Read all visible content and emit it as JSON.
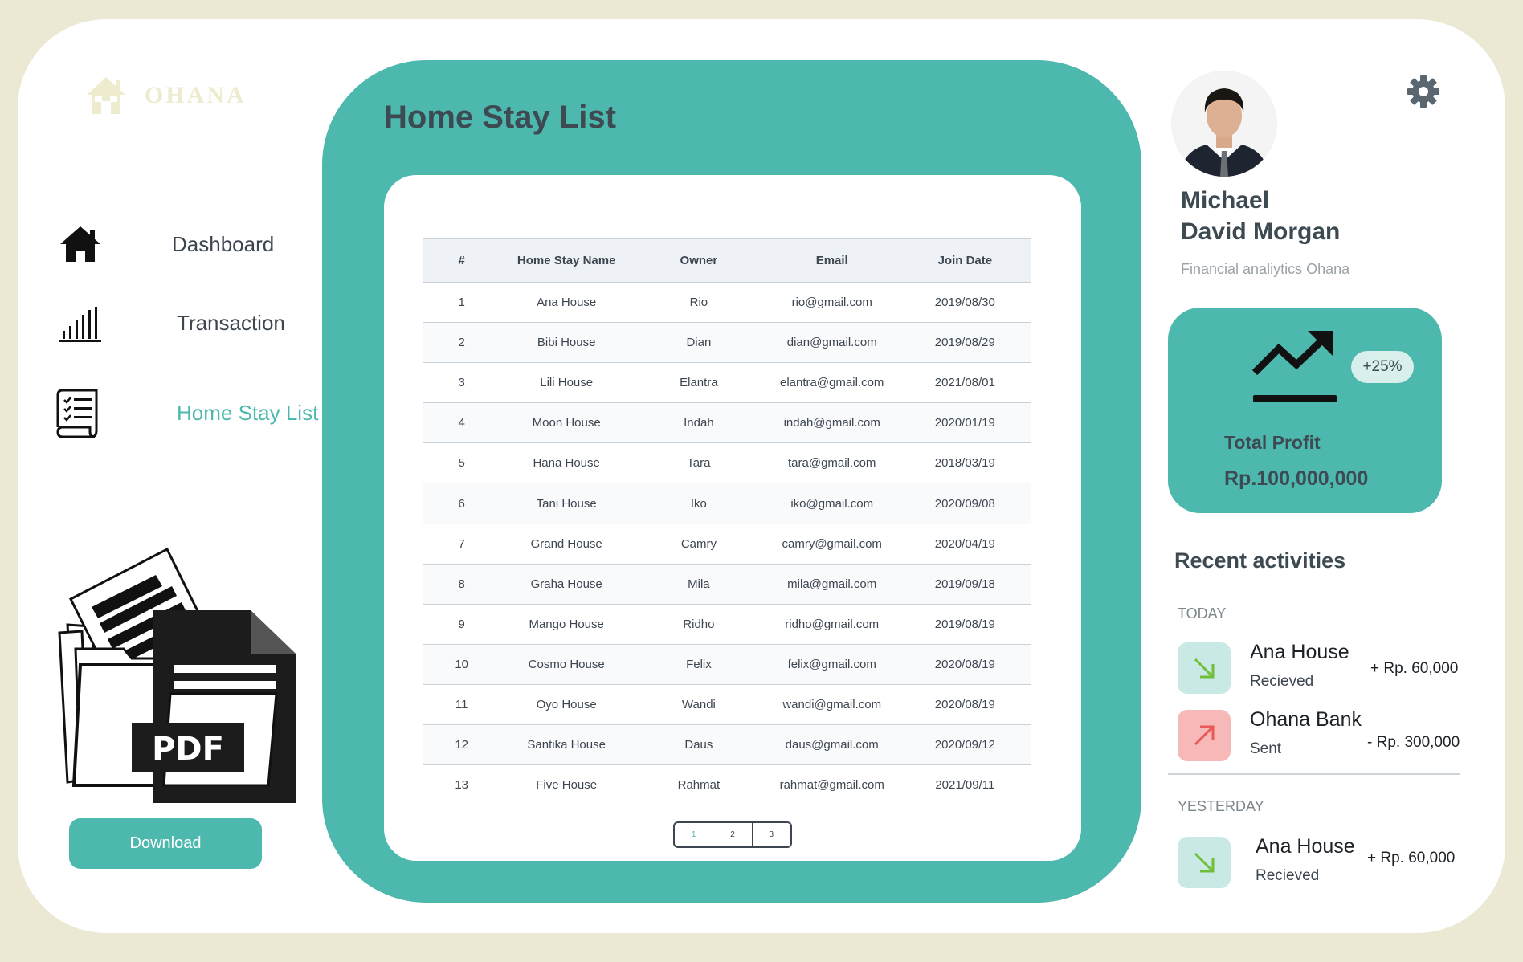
{
  "brand": {
    "name": "OHANA"
  },
  "nav": {
    "items": [
      {
        "label": "Dashboard",
        "icon": "home-icon"
      },
      {
        "label": "Transaction",
        "icon": "bar-chart-icon"
      },
      {
        "label": "Home Stay List",
        "icon": "checklist-icon",
        "active": true
      }
    ]
  },
  "download": {
    "label": "Download",
    "illustration_text": "PDF"
  },
  "main": {
    "title": "Home Stay List",
    "table": {
      "headers": [
        "#",
        "Home Stay Name",
        "Owner",
        "Email",
        "Join Date"
      ],
      "rows": [
        [
          "1",
          "Ana House",
          "Rio",
          "rio@gmail.com",
          "2019/08/30"
        ],
        [
          "2",
          "Bibi House",
          "Dian",
          "dian@gmail.com",
          "2019/08/29"
        ],
        [
          "3",
          "Lili House",
          "Elantra",
          "elantra@gmail.com",
          "2021/08/01"
        ],
        [
          "4",
          "Moon House",
          "Indah",
          "indah@gmail.com",
          "2020/01/19"
        ],
        [
          "5",
          "Hana House",
          "Tara",
          "tara@gmail.com",
          "2018/03/19"
        ],
        [
          "6",
          "Tani House",
          "Iko",
          "iko@gmail.com",
          "2020/09/08"
        ],
        [
          "7",
          "Grand House",
          "Camry",
          "camry@gmail.com",
          "2020/04/19"
        ],
        [
          "8",
          "Graha House",
          "Mila",
          "mila@gmail.com",
          "2019/09/18"
        ],
        [
          "9",
          "Mango House",
          "Ridho",
          "ridho@gmail.com",
          "2019/08/19"
        ],
        [
          "10",
          "Cosmo House",
          "Felix",
          "felix@gmail.com",
          "2020/08/19"
        ],
        [
          "11",
          "Oyo House",
          "Wandi",
          "wandi@gmail.com",
          "2020/08/19"
        ],
        [
          "12",
          "Santika House",
          "Daus",
          "daus@gmail.com",
          "2020/09/12"
        ],
        [
          "13",
          "Five House",
          "Rahmat",
          "rahmat@gmail.com",
          "2021/09/11"
        ]
      ]
    },
    "pagination": {
      "pages": [
        "1",
        "2",
        "3"
      ],
      "current": "1"
    }
  },
  "profile": {
    "name_line1": "Michael",
    "name_line2": "David Morgan",
    "role": "Financial analiytics Ohana"
  },
  "profit": {
    "badge": "+25%",
    "label": "Total Profit",
    "value": "Rp.100,000,000"
  },
  "recent": {
    "title": "Recent activities",
    "today_label": "TODAY",
    "yesterday_label": "YESTERDAY",
    "today": [
      {
        "title": "Ana House",
        "subtitle": "Recieved",
        "amount": "+ Rp. 60,000",
        "direction": "in"
      },
      {
        "title": "Ohana Bank",
        "subtitle": "Sent",
        "amount": "- Rp. 300,000",
        "direction": "out"
      }
    ],
    "yesterday": [
      {
        "title": "Ana House",
        "subtitle": "Recieved",
        "amount": "+ Rp. 60,000",
        "direction": "in"
      }
    ]
  },
  "colors": {
    "accent": "#4db8ae",
    "page_background": "#ebe9d4",
    "received_icon_bg": "#c9e9e4",
    "sent_icon_bg": "#f7b8b8",
    "received_arrow": "#6fbf3a",
    "sent_arrow": "#e85a5a"
  }
}
